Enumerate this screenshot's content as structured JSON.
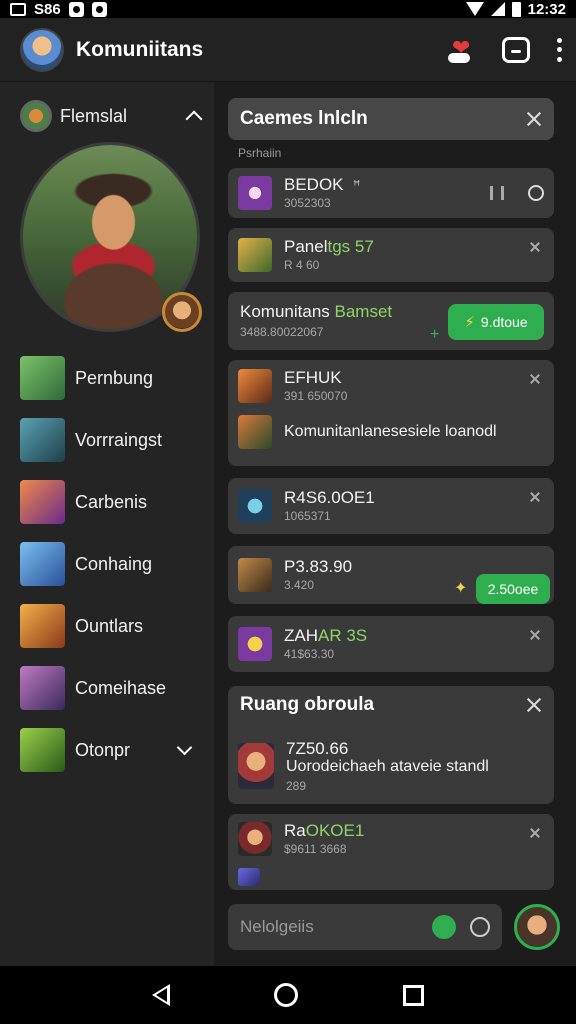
{
  "status_bar": {
    "left_text": "S86",
    "time": "12:32"
  },
  "app": {
    "title": "Komuniitans"
  },
  "sidebar": {
    "header_label": "Flemslal",
    "items": [
      {
        "label": "Pernbung",
        "thumb_color": "#4b8f4a"
      },
      {
        "label": "Vorrraingst",
        "thumb_color": "#2e6e7e"
      },
      {
        "label": "Carbenis",
        "thumb_color": "#c4552e"
      },
      {
        "label": "Conhaing",
        "thumb_color": "#3e7fc2"
      },
      {
        "label": "Ountlars",
        "thumb_color": "#d9742a"
      },
      {
        "label": "Comeihase",
        "thumb_color": "#7b4fa0"
      },
      {
        "label": "Otonpr",
        "thumb_color": "#5aa23a"
      }
    ]
  },
  "panel": {
    "title": "Caemes lnlcln",
    "section_label": "Psrhaiin"
  },
  "cards": {
    "c1": {
      "name": "BEDOK",
      "sub": "3052303",
      "tag": "ꟸ"
    },
    "c2": {
      "name": "Panel",
      "name_hl": "tgs 57",
      "sub": "R 4 60"
    },
    "c3": {
      "name": "Komunitans",
      "name_hl": "Bamset",
      "sub": "3488.80022067",
      "pill": "9.dtoue"
    },
    "c4": {
      "name": "EFHUK",
      "sub": "391 650070",
      "detail": "Komunitanlanesesiele loanodl"
    },
    "c5": {
      "name": "R4S6.0OE1",
      "sub": "1065371"
    },
    "c6": {
      "name": "P3.83.90",
      "sub": "3.420",
      "pill": "2.50oee"
    },
    "c7": {
      "name": "ZAH",
      "name_hl": "AR 3S",
      "sub": "41$63.30"
    },
    "c8": {
      "title": "Ruang obroula",
      "name": "7Z50.66",
      "detail": "Uorodeichaeh ataveie standl",
      "sub": "289"
    },
    "c9": {
      "name": "Ra",
      "name_hl": "OKOE1",
      "sub": "$9611 3668"
    }
  },
  "composer": {
    "placeholder": "Nelolgeiis"
  },
  "colors": {
    "accent_green": "#2fae4f",
    "highlight_green": "#8fd46a",
    "amber": "#f0b041"
  }
}
